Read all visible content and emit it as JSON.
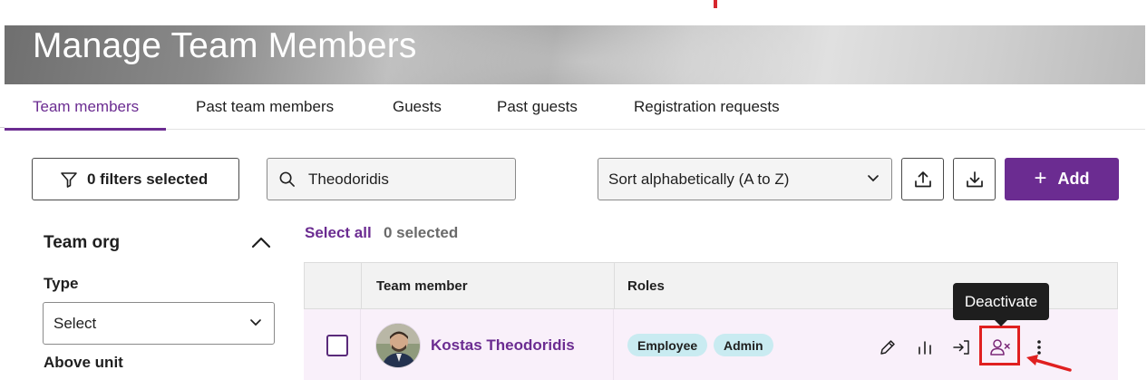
{
  "page": {
    "title": "Manage Team Members"
  },
  "tabs": [
    {
      "label": "Team members",
      "active": true
    },
    {
      "label": "Past team members",
      "active": false
    },
    {
      "label": "Guests",
      "active": false
    },
    {
      "label": "Past guests",
      "active": false
    },
    {
      "label": "Registration requests",
      "active": false
    }
  ],
  "toolbar": {
    "filters_label": "0 filters selected",
    "search_value": "Theodoridis",
    "sort_value": "Sort alphabetically (A to Z)",
    "upload_icon": "upload-icon",
    "download_icon": "download-icon",
    "add_label": "Add"
  },
  "sidebar": {
    "section_title": "Team org",
    "type_label": "Type",
    "type_select_value": "Select",
    "above_unit_label": "Above unit"
  },
  "selection": {
    "select_all_label": "Select all",
    "selected_count": "0 selected"
  },
  "table": {
    "headers": [
      "Team member",
      "Roles"
    ],
    "rows": [
      {
        "name": "Kostas Theodoridis",
        "roles": [
          "Employee",
          "Admin"
        ],
        "actions": [
          "pencil-icon",
          "bar-chart-icon",
          "sign-in-icon",
          "user-deactivate-icon",
          "more-vertical-icon"
        ]
      }
    ]
  },
  "tooltip": {
    "text": "Deactivate"
  },
  "colors": {
    "accent": "#6b2c91",
    "role_badge": "#c9ebf1",
    "highlight_red": "#e02020",
    "row_background": "#f9f0fa",
    "tooltip_background": "#1e1e1e"
  }
}
